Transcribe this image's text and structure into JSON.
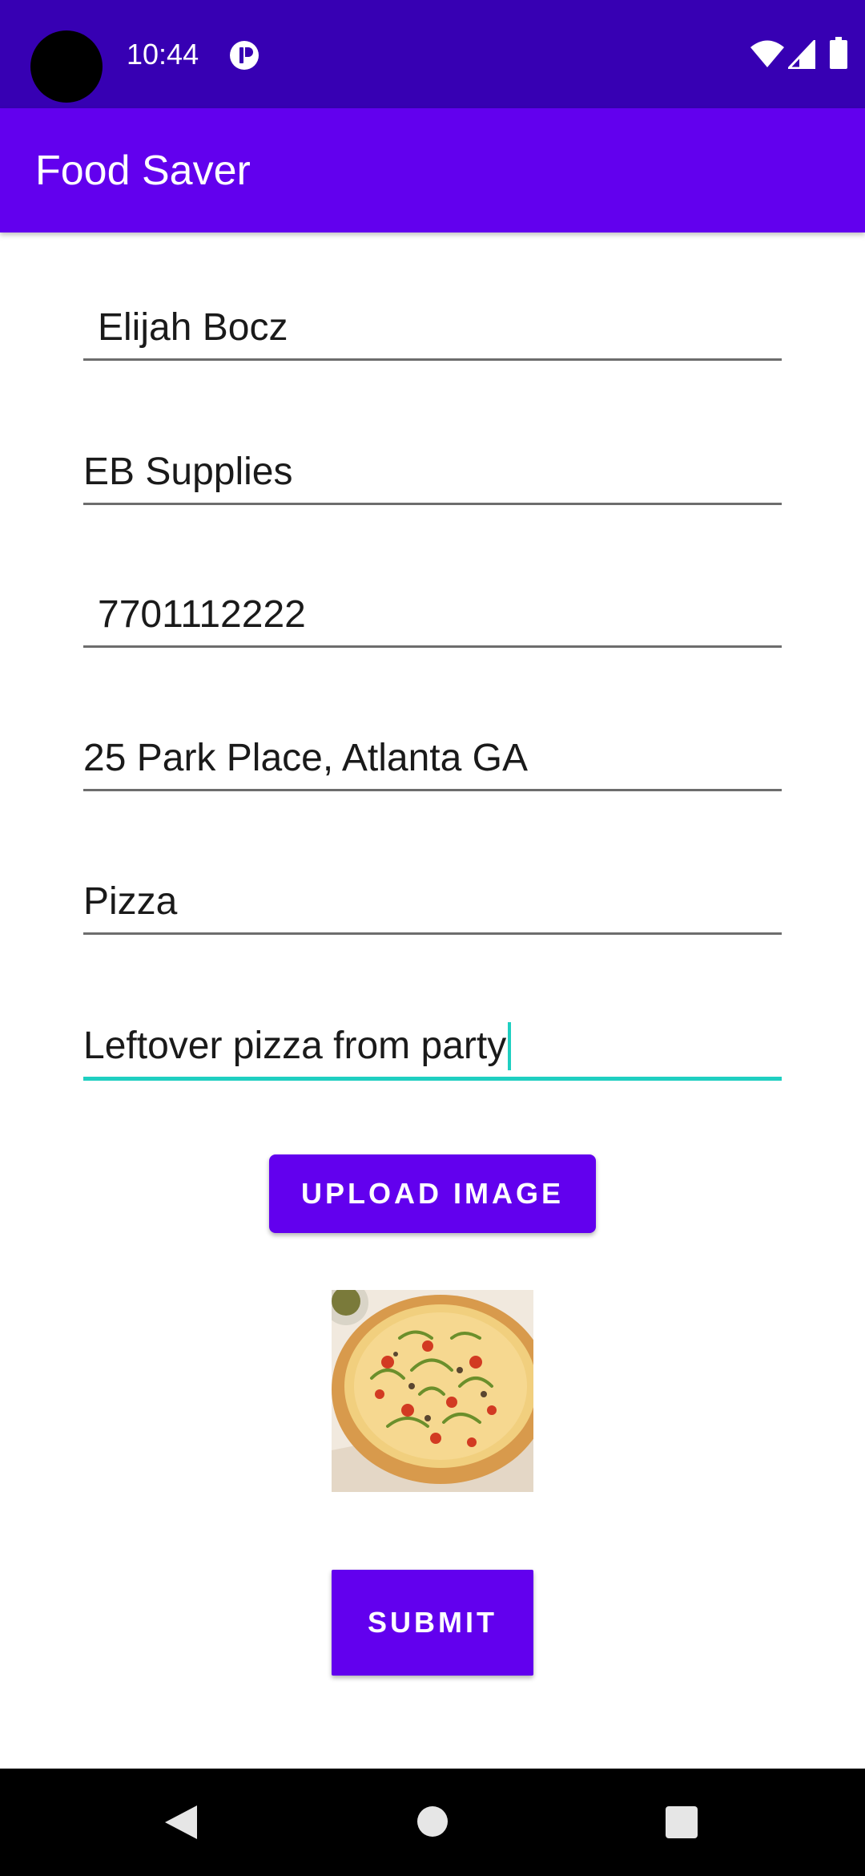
{
  "status_bar": {
    "time": "10:44",
    "icons": [
      "notification-icon",
      "wifi-icon",
      "signal-icon",
      "battery-icon"
    ]
  },
  "app_bar": {
    "title": "Food Saver"
  },
  "form": {
    "name": "Elijah Bocz",
    "business": "EB Supplies",
    "phone": "7701112222",
    "address": "25 Park Place, Atlanta GA",
    "food_type": "Pizza",
    "description": "Leftover pizza from party"
  },
  "buttons": {
    "upload_label": "UPLOAD IMAGE",
    "submit_label": "SUBMIT"
  },
  "image": {
    "subject": "pizza"
  },
  "nav_bar": {
    "icons": [
      "back-icon",
      "home-icon",
      "recents-icon"
    ]
  },
  "colors": {
    "status_bar": "#3700B3",
    "primary": "#6200EE",
    "focus_accent": "#1fcfc1"
  }
}
